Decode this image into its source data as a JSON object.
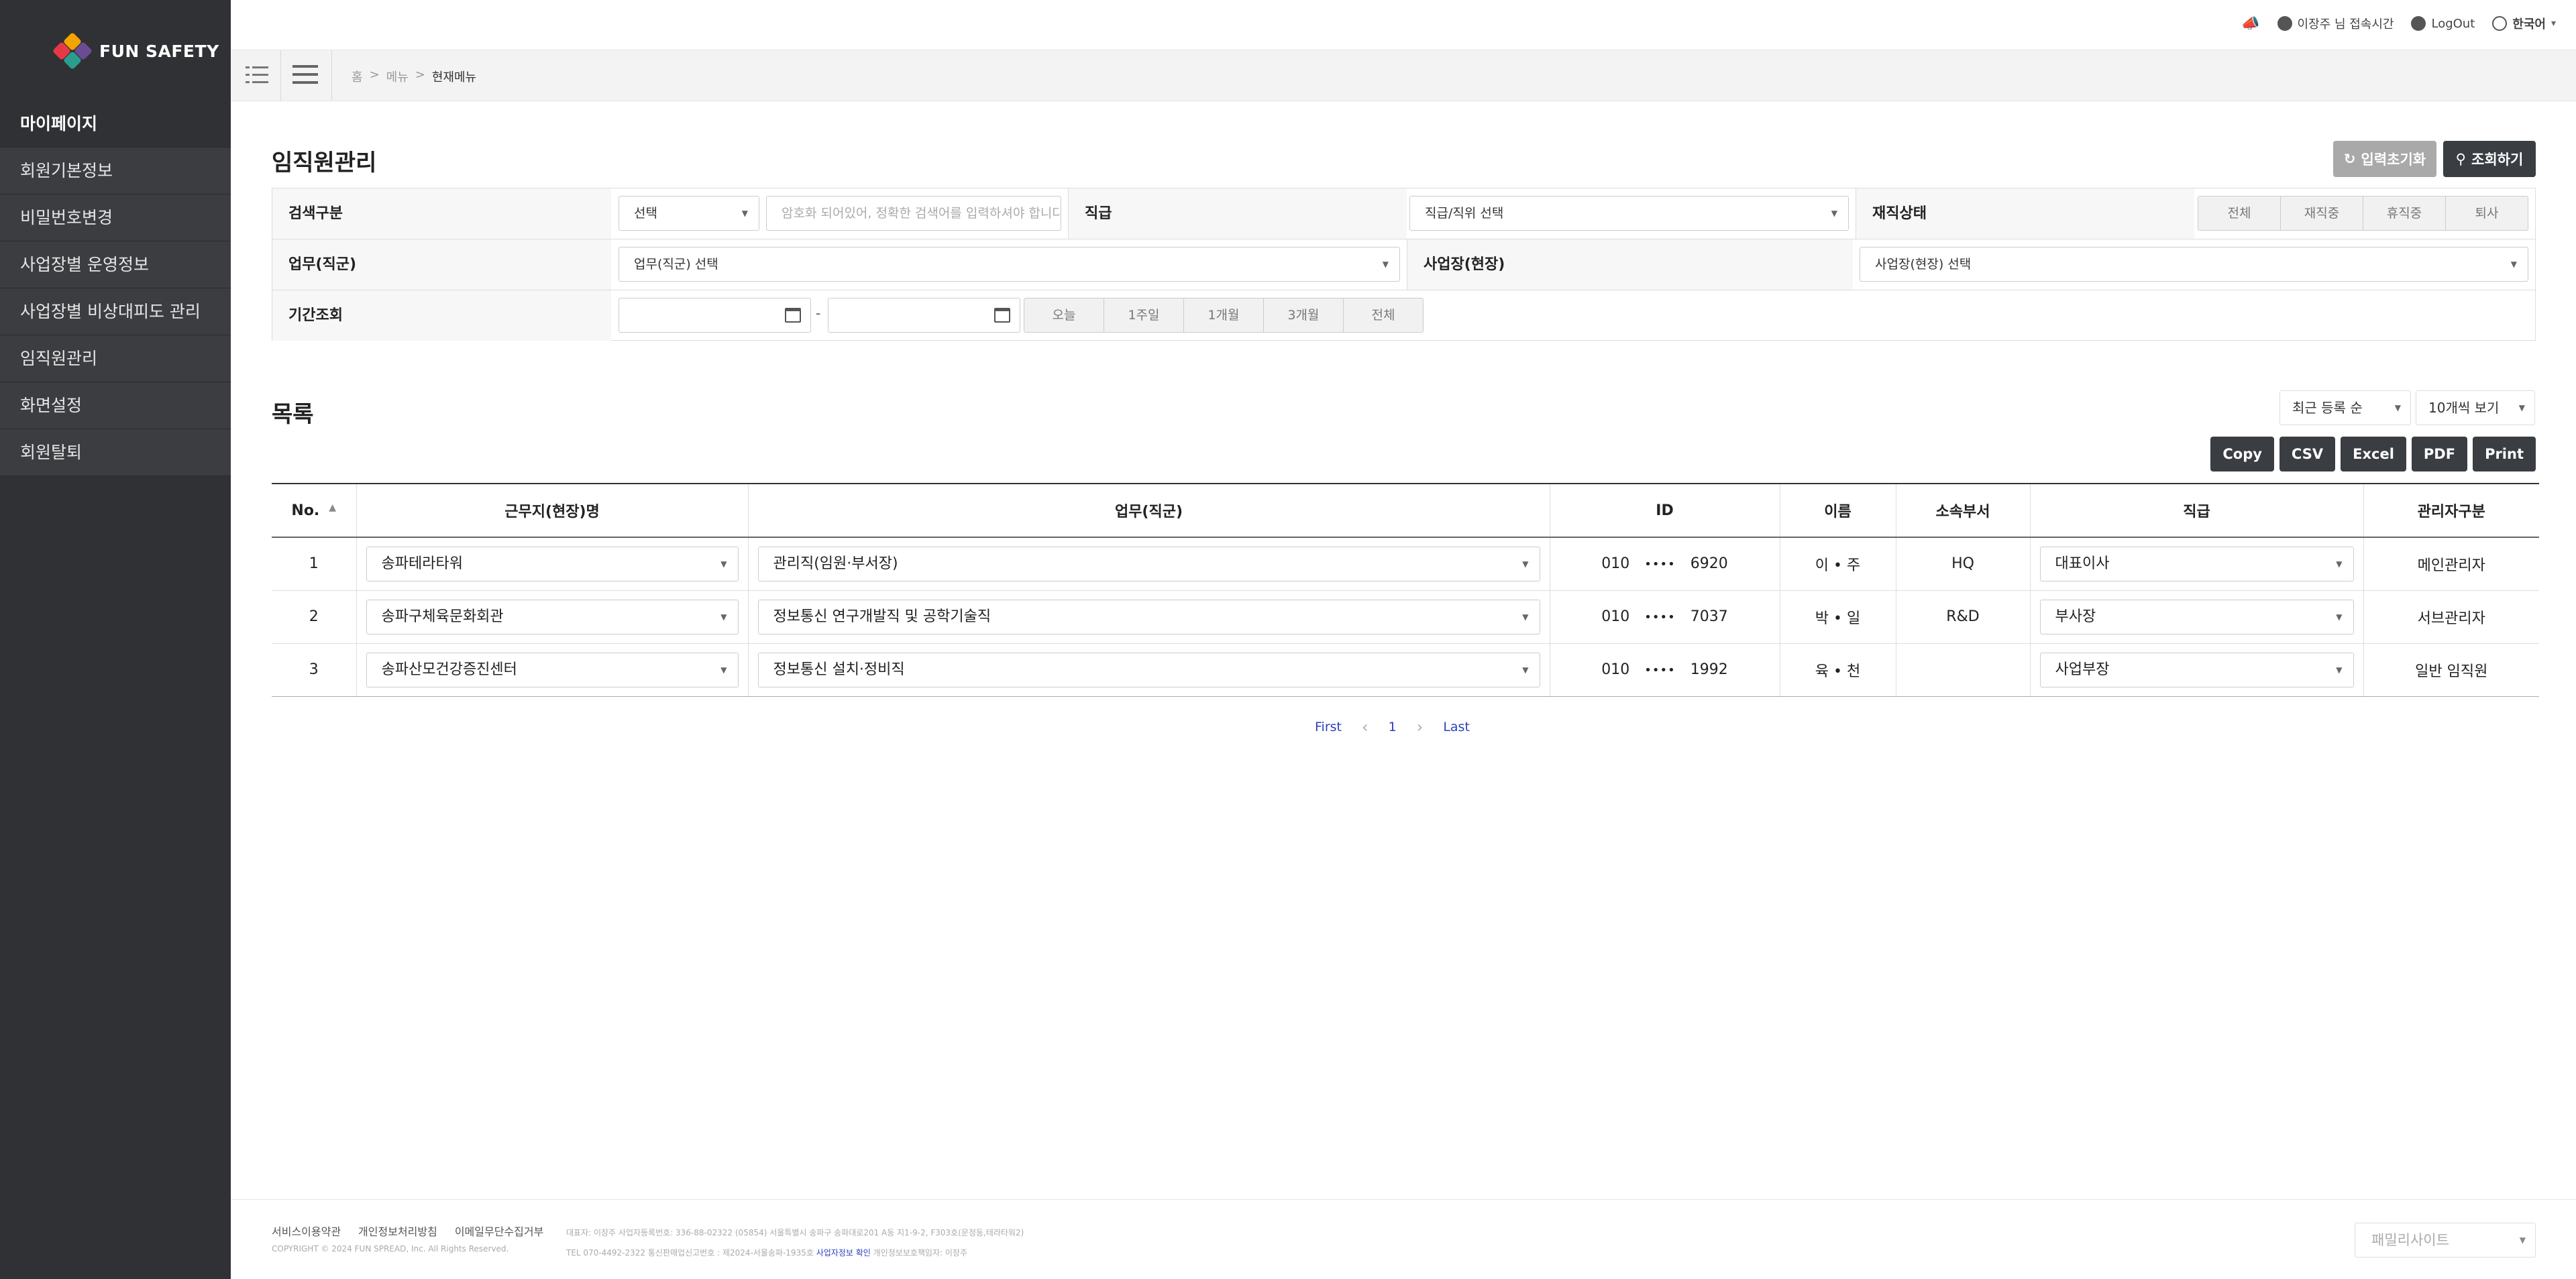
{
  "brand": {
    "name": "FUN SAFETY"
  },
  "sidebar": {
    "items": [
      {
        "label": "마이페이지"
      },
      {
        "label": "회원기본정보"
      },
      {
        "label": "비밀번호변경"
      },
      {
        "label": "사업장별 운영정보"
      },
      {
        "label": "사업장별 비상대피도 관리"
      },
      {
        "label": "임직원관리"
      },
      {
        "label": "화면설정"
      },
      {
        "label": "회원탈퇴"
      }
    ]
  },
  "topbar": {
    "user_text": "이장주 님 접속시간",
    "logout": "LogOut",
    "language": "한국어"
  },
  "breadcrumb": {
    "home": "홈",
    "menu": "메뉴",
    "current": "현재메뉴",
    "sep": ">"
  },
  "page": {
    "title": "임직원관리",
    "reset_label": "입력초기화",
    "search_label": "조회하기"
  },
  "filter": {
    "search_type_label": "검색구분",
    "search_type_value": "선택",
    "search_placeholder": "암호화 되어있어, 정확한 검색어를 입력하셔야 합니다",
    "rank_label": "직급",
    "rank_value": "직급/직위 선택",
    "status_label": "재직상태",
    "status_options": [
      "전체",
      "재직중",
      "휴직중",
      "퇴사"
    ],
    "job_label": "업무(직군)",
    "job_value": "업무(직군) 선택",
    "site_label": "사업장(현장)",
    "site_value": "사업장(현장) 선택",
    "period_label": "기간조회",
    "date_sep": "-",
    "period_options": [
      "오늘",
      "1주일",
      "1개월",
      "3개월",
      "전체"
    ]
  },
  "list": {
    "title": "목록",
    "sort_value": "최근 등록 순",
    "count_value": "10개씩 보기",
    "export": [
      "Copy",
      "CSV",
      "Excel",
      "PDF",
      "Print"
    ],
    "columns": [
      "No.",
      "근무지(현장)명",
      "업무(직군)",
      "ID",
      "이름",
      "소속부서",
      "직급",
      "관리자구분"
    ],
    "rows": [
      {
        "no": "1",
        "site": "송파테라타워",
        "job": "관리직(임원·부서장)",
        "id_pre": "010",
        "id_mask": "••••",
        "id_post": "6920",
        "name": "이 • 주",
        "dept": "HQ",
        "rank": "대표이사",
        "admin": "메인관리자"
      },
      {
        "no": "2",
        "site": "송파구체육문화회관",
        "job": "정보통신 연구개발직 및 공학기술직",
        "id_pre": "010",
        "id_mask": "••••",
        "id_post": "7037",
        "name": "박 • 일",
        "dept": "R&D",
        "rank": "부사장",
        "admin": "서브관리자"
      },
      {
        "no": "3",
        "site": "송파산모건강증진센터",
        "job": "정보통신 설치·정비직",
        "id_pre": "010",
        "id_mask": "••••",
        "id_post": "1992",
        "name": "육 • 천",
        "dept": "",
        "rank": "사업부장",
        "admin": "일반 임직원"
      }
    ]
  },
  "pager": {
    "first": "First",
    "current": "1",
    "last": "Last"
  },
  "footer": {
    "links": [
      "서비스이용약관",
      "개인정보처리방침",
      "이메일무단수집거부"
    ],
    "copyright": "COPYRIGHT © 2024 FUN SPREAD, Inc. All Rights Reserved.",
    "info1": "대표자: 이장주 사업자등록번호: 336-88-02322 (05854) 서울특별시 송파구 송파대로201 A동 지1-9-2, F303호(문정동,테라타워2)",
    "info2": "TEL 070-4492-2322 통신판매업신고번호 : 제2024-서울송파-1935호",
    "info2_link": "사업자정보 확인",
    "info2_tail": "개인정보보호책임자: 이장주",
    "family_site": "패밀리사이트"
  },
  "colors": {
    "sidebar_bg": "#2f3134",
    "dark_button": "#3a3d42",
    "link_blue": "#2c3fbf"
  }
}
